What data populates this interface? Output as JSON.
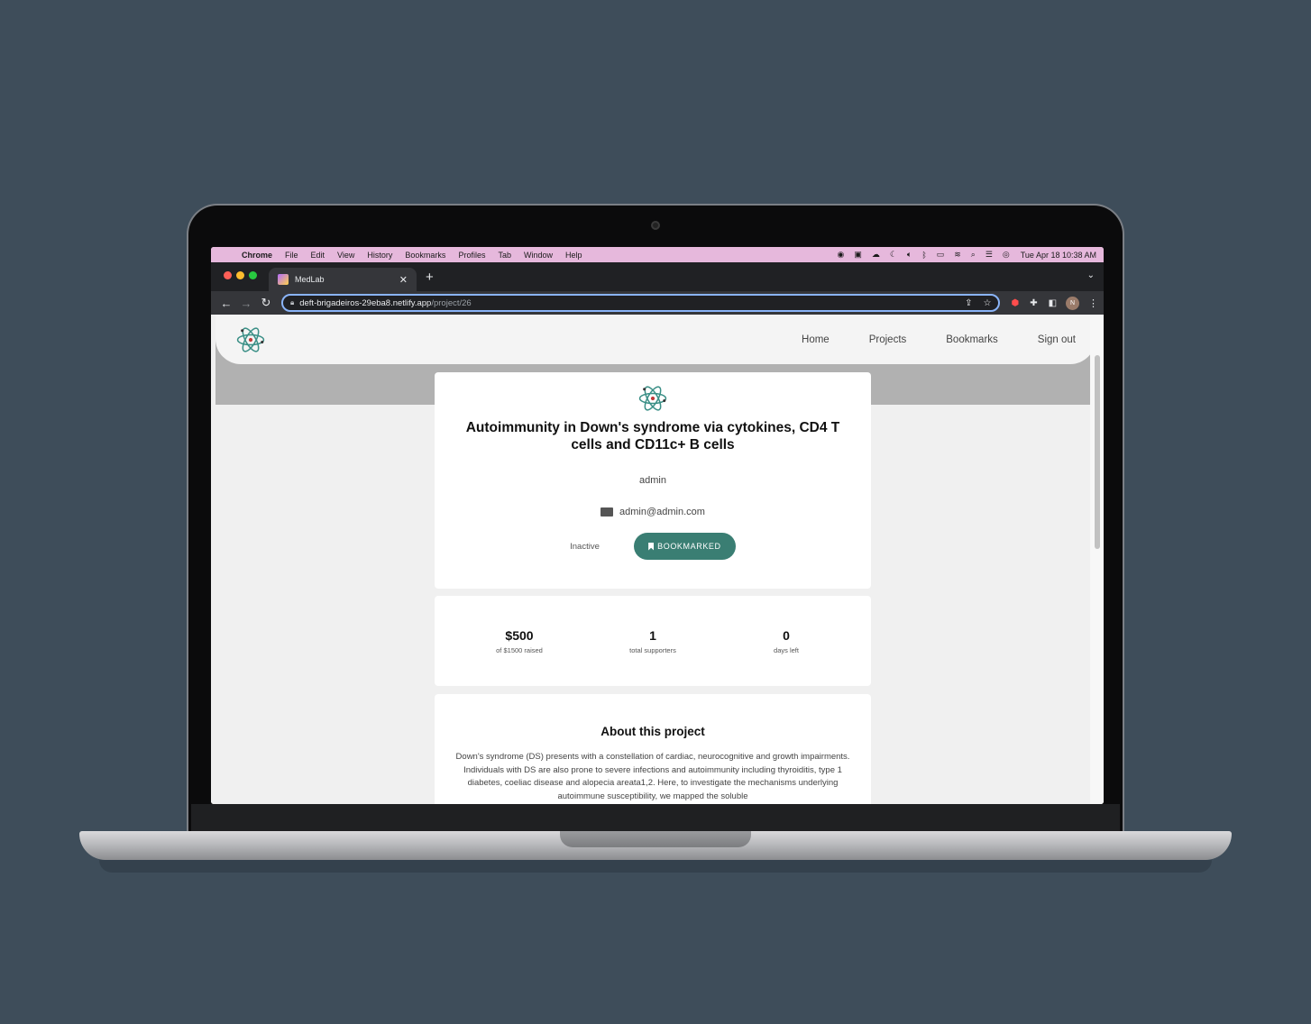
{
  "menubar": {
    "app": "Chrome",
    "items": [
      "File",
      "Edit",
      "View",
      "History",
      "Bookmarks",
      "Profiles",
      "Tab",
      "Window",
      "Help"
    ],
    "clock": "Tue Apr 18  10:38 AM"
  },
  "browser": {
    "tab_title": "MedLab",
    "url_host": "deft-brigadeiros-29eba8.netlify.app",
    "url_path": "/project/26",
    "avatar_initial": "N"
  },
  "site": {
    "nav": [
      "Home",
      "Projects",
      "Bookmarks",
      "Sign out"
    ]
  },
  "project": {
    "title": "Autoimmunity in Down's syndrome via cytokines, CD4 T cells and CD11c+ B cells",
    "owner": "admin",
    "email": "admin@admin.com",
    "status": "Inactive",
    "bookmark_label": "BOOKMARKED",
    "accent_color": "#3a7e73"
  },
  "stats": [
    {
      "value": "$500",
      "label": "of $1500 raised"
    },
    {
      "value": "1",
      "label": "total supporters"
    },
    {
      "value": "0",
      "label": "days left"
    }
  ],
  "about": {
    "heading": "About this project",
    "body": "Down's syndrome (DS) presents with a constellation of cardiac, neurocognitive and growth impairments. Individuals with DS are also prone to severe infections and autoimmunity including thyroiditis, type 1 diabetes, coeliac disease and alopecia areata1,2. Here, to investigate the mechanisms underlying autoimmune susceptibility, we mapped the soluble"
  }
}
